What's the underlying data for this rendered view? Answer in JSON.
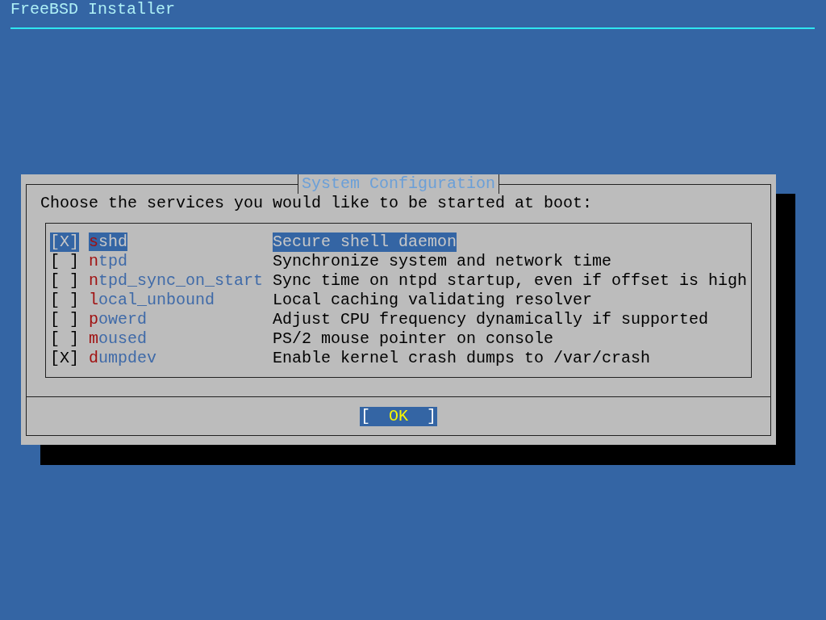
{
  "header": {
    "title": "FreeBSD Installer"
  },
  "dialog": {
    "title": "System Configuration",
    "prompt": "Choose the services you would like to be started at boot:",
    "items": [
      {
        "box": "[X]",
        "name": "sshd",
        "description": "Secure shell daemon",
        "selected": true
      },
      {
        "box": "[ ]",
        "name": "ntpd",
        "description": "Synchronize system and network time",
        "selected": false
      },
      {
        "box": "[ ]",
        "name": "ntpd_sync_on_start",
        "description": "Sync time on ntpd startup, even if offset is high",
        "selected": false
      },
      {
        "box": "[ ]",
        "name": "local_unbound",
        "description": "Local caching validating resolver",
        "selected": false
      },
      {
        "box": "[ ]",
        "name": "powerd",
        "description": "Adjust CPU frequency dynamically if supported",
        "selected": false
      },
      {
        "box": "[ ]",
        "name": "moused",
        "description": "PS/2 mouse pointer on console",
        "selected": false
      },
      {
        "box": "[X]",
        "name": "dumpdev",
        "description": "Enable kernel crash dumps to /var/crash",
        "selected": false
      }
    ],
    "buttons": [
      {
        "open": "[",
        "label": "OK",
        "close": "]"
      }
    ]
  }
}
